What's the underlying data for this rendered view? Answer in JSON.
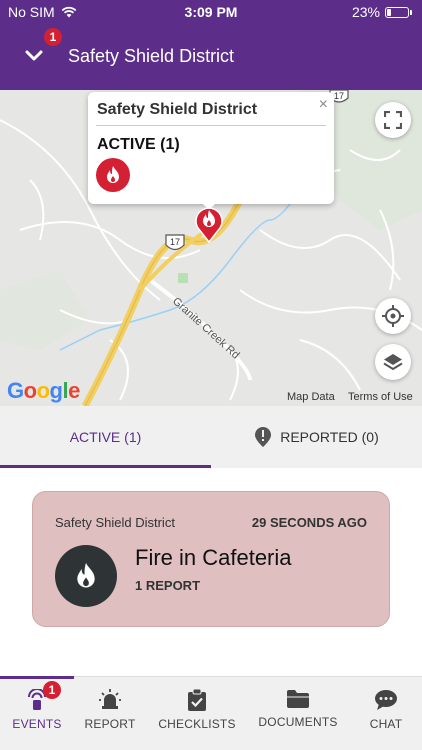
{
  "status_bar": {
    "carrier": "No SIM",
    "time": "3:09 PM",
    "battery": "23%",
    "battery_level": 0.23
  },
  "header": {
    "title": "Safety Shield District",
    "badge": "1"
  },
  "map": {
    "popup": {
      "title": "Safety Shield District",
      "close": "×",
      "active_label": "ACTIVE (1)"
    },
    "road_shields": [
      "17",
      "17"
    ],
    "road_label": "Granite Creek Rd",
    "logo": "Google",
    "map_data": "Map Data",
    "terms": "Terms of Use",
    "icons": [
      "fullscreen-icon",
      "crosshair-icon",
      "layers-icon",
      "fire-icon"
    ]
  },
  "tabs": [
    {
      "label": "ACTIVE (1)"
    },
    {
      "label": "REPORTED (0)"
    }
  ],
  "event_card": {
    "district": "Safety Shield District",
    "time_ago": "29 SECONDS AGO",
    "title": "Fire in Cafeteria",
    "reports": "1 REPORT"
  },
  "nav": {
    "events_badge": "1",
    "items": [
      {
        "label": "EVENTS"
      },
      {
        "label": "REPORT"
      },
      {
        "label": "CHECKLISTS"
      },
      {
        "label": "DOCUMENTS"
      },
      {
        "label": "CHAT"
      }
    ]
  },
  "colors": {
    "brand": "#5c2e8a",
    "alert": "#d32032",
    "card": "#dfbfbf",
    "icon_dark": "#2e3436"
  }
}
